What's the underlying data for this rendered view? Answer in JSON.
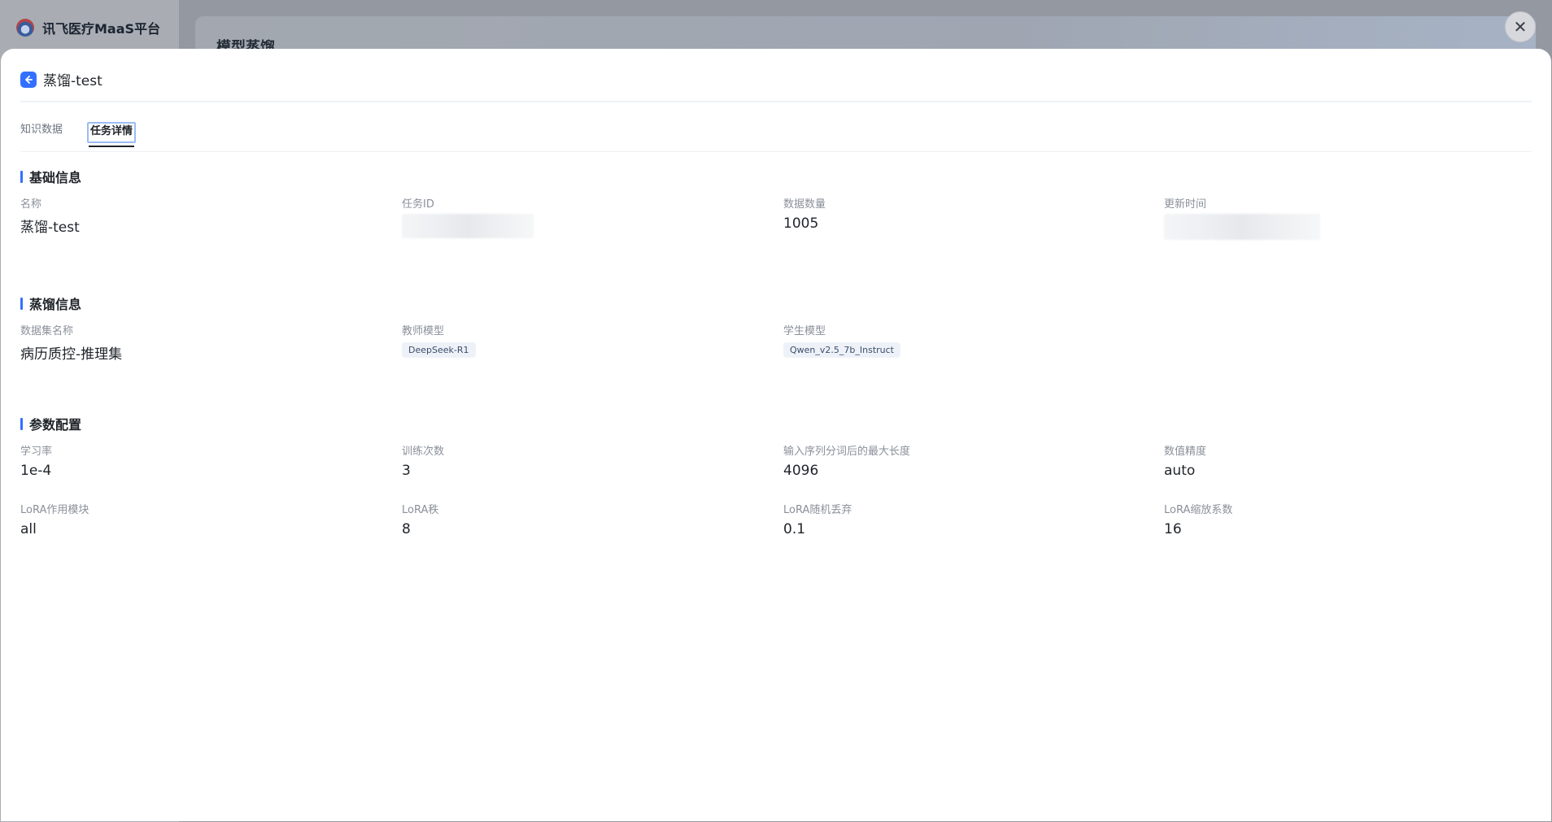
{
  "background": {
    "brand_name": "讯飞医疗MaaS平台",
    "page_title": "模型蒸馏"
  },
  "modal": {
    "title": "蒸馏-test",
    "tabs": [
      {
        "label": "知识数据",
        "active": false
      },
      {
        "label": "任务详情",
        "active": true
      }
    ],
    "basic_info": {
      "heading": "基础信息",
      "name_label": "名称",
      "name_value": "蒸馏-test",
      "task_id_label": "任务ID",
      "data_count_label": "数据数量",
      "data_count_value": "1005",
      "update_time_label": "更新时间"
    },
    "distill_info": {
      "heading": "蒸馏信息",
      "dataset_label": "数据集名称",
      "dataset_value": "病历质控-推理集",
      "teacher_label": "教师模型",
      "teacher_value": "DeepSeek-R1",
      "student_label": "学生模型",
      "student_value": "Qwen_v2.5_7b_Instruct"
    },
    "params": {
      "heading": "参数配置",
      "items": [
        {
          "label": "学习率",
          "value": "1e-4"
        },
        {
          "label": "训练次数",
          "value": "3"
        },
        {
          "label": "输入序列分词后的最大长度",
          "value": "4096"
        },
        {
          "label": "数值精度",
          "value": "auto"
        },
        {
          "label": "LoRA作用模块",
          "value": "all"
        },
        {
          "label": "LoRA秩",
          "value": "8"
        },
        {
          "label": "LoRA随机丢弃",
          "value": "0.1"
        },
        {
          "label": "LoRA缩放系数",
          "value": "16"
        }
      ]
    }
  },
  "colors": {
    "accent": "#3370ff",
    "overlay": "#8e939b"
  },
  "icons": {
    "back": "arrow-left-icon",
    "close": "close-icon",
    "logo": "brand-logo-icon"
  }
}
